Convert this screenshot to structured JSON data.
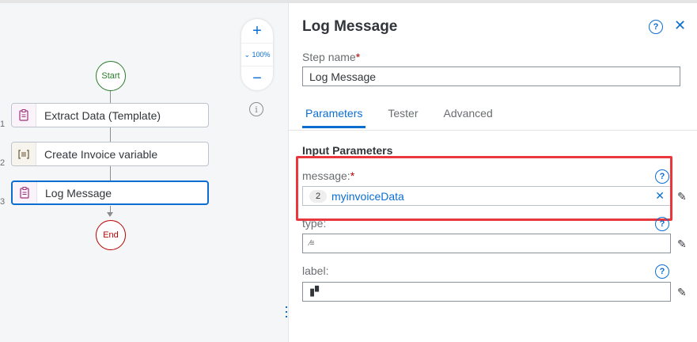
{
  "canvas": {
    "start_label": "Start",
    "end_label": "End",
    "zoom": {
      "plus": "+",
      "level": "⌄ 100%",
      "minus": "−"
    },
    "steps": [
      {
        "num": "1",
        "label": "Extract Data (Template)"
      },
      {
        "num": "2",
        "label": "Create Invoice variable"
      },
      {
        "num": "3",
        "label": "Log Message"
      }
    ]
  },
  "panel": {
    "title": "Log Message",
    "step_name_label": "Step name",
    "required_mark": "*",
    "step_name_value": "Log Message",
    "tabs": [
      "Parameters",
      "Tester",
      "Advanced"
    ],
    "section_title": "Input Parameters",
    "params": {
      "message": {
        "label": "message:",
        "chip": "2",
        "value": "myinvoiceData"
      },
      "type": {
        "label": "type:"
      },
      "label": {
        "label": "label:"
      }
    }
  },
  "colors": {
    "accent": "#0a6ed1",
    "required": "#bb0000",
    "highlight": "#e8383d",
    "start": "#2b7d2b"
  }
}
